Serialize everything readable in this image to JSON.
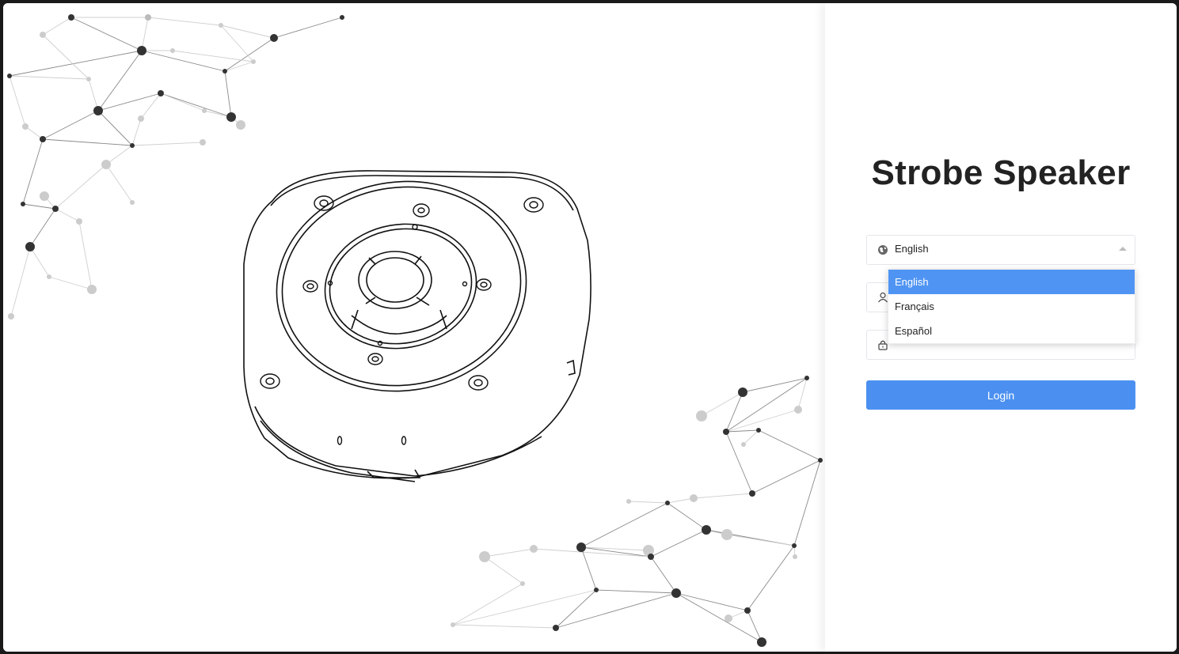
{
  "app": {
    "title": "Strobe Speaker"
  },
  "language_select": {
    "value": "English",
    "icon": "globe-icon",
    "options": [
      {
        "label": "English",
        "selected": true
      },
      {
        "label": "Français",
        "selected": false
      },
      {
        "label": "Español",
        "selected": false
      }
    ]
  },
  "username_field": {
    "icon": "user-icon",
    "value": ""
  },
  "password_field": {
    "icon": "lock-icon",
    "value": ""
  },
  "login_button": {
    "label": "Login"
  },
  "colors": {
    "accent": "#4b90f1",
    "selected_option": "#4f94f3",
    "title": "#222222"
  }
}
